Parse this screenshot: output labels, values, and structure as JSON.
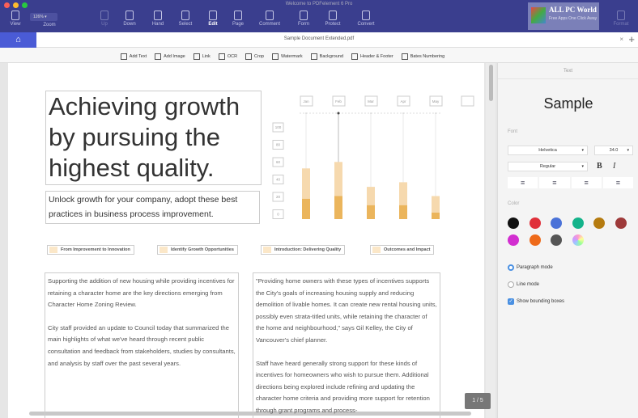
{
  "window": {
    "title": "Welcome to PDFelement 6 Pro"
  },
  "toolbar": {
    "zoom_value": "126%",
    "items": [
      {
        "label": "View",
        "dim": false
      },
      {
        "label": "Zoom",
        "dim": false
      },
      {
        "label": "Up",
        "dim": true
      },
      {
        "label": "Down",
        "dim": false
      },
      {
        "label": "Hand",
        "dim": false
      },
      {
        "label": "Select",
        "dim": false
      },
      {
        "label": "Edit",
        "dim": false
      },
      {
        "label": "Page",
        "dim": false
      },
      {
        "label": "Comment",
        "dim": false
      },
      {
        "label": "Form",
        "dim": false
      },
      {
        "label": "Protect",
        "dim": false
      },
      {
        "label": "Convert",
        "dim": false
      },
      {
        "label": "Format",
        "dim": true
      }
    ]
  },
  "watermark": {
    "title": "ALL PC World",
    "subtitle": "Free Apps One Click Away"
  },
  "tabs": {
    "document": "Sample Document Extended.pdf",
    "close": "×",
    "add": "+"
  },
  "edit_toolbar": [
    "Add Text",
    "Add Image",
    "Link",
    "OCR",
    "Crop",
    "Watermark",
    "Background",
    "Header & Footer",
    "Bates Numbering"
  ],
  "document": {
    "headline": "Achieving growth by pursuing the highest quality.",
    "subheading": "Unlock growth for your company, adopt these best practices in business process improvement.",
    "tags": [
      "From Improvement to Innovation",
      "Identify Growth Opportunities",
      "Introduction: Delivering Quality",
      "Outcomes and Impact"
    ],
    "col1": [
      "Supporting the addition of new housing while providing incentives for retaining a character home are the key directions emerging from Character Home Zoning Review.",
      "City staff provided an update to Council today that summarized the main highlights of what we've heard through recent public consultation and feedback from stakeholders, studies by consultants, and analysis by staff over the past several years."
    ],
    "col2": [
      "\"Providing home owners with these types of incentives supports the City's goals of increasing housing supply and reducing demolition of livable homes.  It can create new rental housing units, possibly even strata-titled units, while retaining the character of the home and neighbourhood,\" says Gil Kelley, the City of Vancouver's chief planner.",
      "Staff have heard generally strong support for these kinds of incentives for homeowners who wish to pursue them. Additional directions being explored include refining and updating the character home criteria and providing more support for retention through grant programs and process-"
    ],
    "page_indicator": "1 / 5"
  },
  "chart_data": {
    "type": "bar",
    "categories": [
      "Jan",
      "Feb",
      "Mar",
      "Apr",
      "May"
    ],
    "yticks": [
      "100",
      "80",
      "60",
      "40",
      "20",
      "0"
    ],
    "ylim": [
      0,
      100
    ],
    "series": [
      {
        "name": "total",
        "values": [
          55,
          62,
          35,
          40,
          25
        ],
        "color": "#f6d9ae"
      },
      {
        "name": "base",
        "values": [
          22,
          25,
          15,
          15,
          7
        ],
        "color": "#ebb55c"
      }
    ]
  },
  "panel": {
    "header": "Text",
    "sample": "Sample",
    "font_label": "Font",
    "font": "Helvetica",
    "size": "34.0",
    "style": "Regular",
    "bold": "B",
    "italic": "I",
    "align": [
      "≡",
      "≡",
      "≡",
      "≡"
    ],
    "color_label": "Color",
    "colors": [
      "#111111",
      "#e0303a",
      "#4a72d8",
      "#14b38a",
      "#b57b10",
      "#9e3a3a",
      "#d22ed0",
      "#ee6a1a",
      "#555555",
      "#d8c8f0"
    ],
    "paragraph_mode": "Paragraph mode",
    "line_mode": "Line mode",
    "show_boxes": "Show bounding boxes"
  }
}
